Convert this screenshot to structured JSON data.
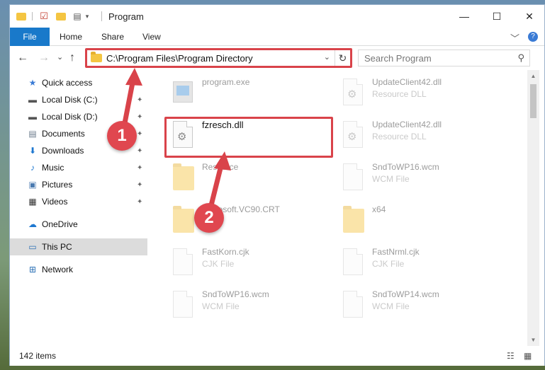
{
  "window": {
    "title": "Program",
    "controls": {
      "minimize": "—",
      "maximize": "☐",
      "close": "✕"
    }
  },
  "ribbon": {
    "tabs": [
      "File",
      "Home",
      "Share",
      "View"
    ],
    "expand_icon": "﹀",
    "help_icon": "?"
  },
  "nav": {
    "back": "←",
    "forward": "→",
    "recent": "⌄",
    "up": "↑"
  },
  "address": {
    "path": "C:\\Program Files\\Program Directory",
    "dropdown": "⌄",
    "refresh": "↻"
  },
  "search": {
    "placeholder": "Search Program",
    "icon": "⚲"
  },
  "sidebar": {
    "items": [
      {
        "label": "Quick access",
        "icon": "★",
        "pinned": false
      },
      {
        "label": "Local Disk (C:)",
        "icon": "▬",
        "pinned": true
      },
      {
        "label": "Local Disk (D:)",
        "icon": "▬",
        "pinned": true
      },
      {
        "label": "Documents",
        "icon": "▤",
        "pinned": true
      },
      {
        "label": "Downloads",
        "icon": "⬇",
        "pinned": true
      },
      {
        "label": "Music",
        "icon": "♪",
        "pinned": true
      },
      {
        "label": "Pictures",
        "icon": "▣",
        "pinned": true
      },
      {
        "label": "Videos",
        "icon": "▦",
        "pinned": true
      },
      {
        "label": "OneDrive",
        "icon": "☁",
        "pinned": false
      },
      {
        "label": "This PC",
        "icon": "▭",
        "pinned": false
      },
      {
        "label": "Network",
        "icon": "⊞",
        "pinned": false
      }
    ],
    "pin_glyph": "📌"
  },
  "files": [
    {
      "name": "program.exe",
      "type": "",
      "kind": "exe"
    },
    {
      "name": "UpdateClient42.dll",
      "type": "Resource DLL",
      "kind": "dll"
    },
    {
      "name": "fzresch.dll",
      "type": "",
      "kind": "dll"
    },
    {
      "name": "UpdateClient42.dll",
      "type": "Resource DLL",
      "kind": "dll"
    },
    {
      "name": "Resource",
      "type": "",
      "kind": "folder"
    },
    {
      "name": "SndToWP16.wcm",
      "type": "WCM File",
      "kind": "doc"
    },
    {
      "name": "Microsoft.VC90.CRT",
      "type": "",
      "kind": "folder"
    },
    {
      "name": "x64",
      "type": "",
      "kind": "folder"
    },
    {
      "name": "FastKorn.cjk",
      "type": "CJK File",
      "kind": "doc"
    },
    {
      "name": "FastNrml.cjk",
      "type": "CJK File",
      "kind": "doc"
    },
    {
      "name": "SndToWP16.wcm",
      "type": "WCM File",
      "kind": "doc"
    },
    {
      "name": "SndToWP14.wcm",
      "type": "WCM File",
      "kind": "doc"
    }
  ],
  "annotations": {
    "step1": "1",
    "step2": "2",
    "color": "#d9434a"
  },
  "status": {
    "item_count": "142 items",
    "details_view_icon": "☷",
    "tiles_view_icon": "▦"
  }
}
